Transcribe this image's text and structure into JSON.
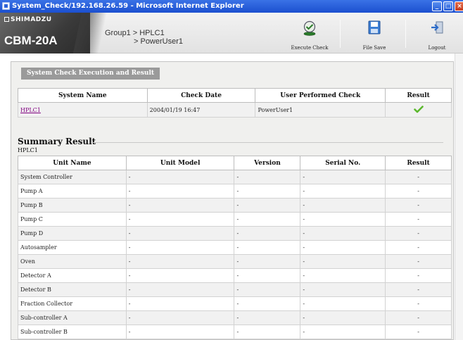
{
  "window": {
    "title": "System_Check/192.168.26.59 - Microsoft Internet Explorer"
  },
  "header": {
    "brand": "SHIMADZU",
    "model": "CBM-20A",
    "breadcrumb": [
      {
        "text": "Group1  >  HPLC1"
      },
      {
        "text": ">  PowerUser1"
      }
    ],
    "tools": {
      "execute_check": "Execute Check",
      "file_save": "File Save",
      "logout": "Logout"
    }
  },
  "section": {
    "tab_label": "System Check Execution and Result"
  },
  "check_table": {
    "headers": [
      "System Name",
      "Check Date",
      "User Performed Check",
      "Result"
    ],
    "row": {
      "system_name": "HPLC1",
      "check_date": "2004/01/19  16:47",
      "user": "PowerUser1",
      "result_icon": "checkmark-icon"
    }
  },
  "summary": {
    "title": "Summary Result",
    "subtitle": "HPLC1",
    "headers": [
      "Unit Name",
      "Unit Model",
      "Version",
      "Serial No.",
      "Result"
    ],
    "rows": [
      {
        "unit": "System Controller",
        "model": "-",
        "version": "-",
        "serial": "-",
        "result": "-"
      },
      {
        "unit": "Pump A",
        "model": "-",
        "version": "-",
        "serial": "-",
        "result": "-"
      },
      {
        "unit": "Pump B",
        "model": "-",
        "version": "-",
        "serial": "-",
        "result": "-"
      },
      {
        "unit": "Pump C",
        "model": "-",
        "version": "-",
        "serial": "-",
        "result": "-"
      },
      {
        "unit": "Pump D",
        "model": "-",
        "version": "-",
        "serial": "-",
        "result": "-"
      },
      {
        "unit": "Autosampler",
        "model": "-",
        "version": "-",
        "serial": "-",
        "result": "-"
      },
      {
        "unit": "Oven",
        "model": "-",
        "version": "-",
        "serial": "-",
        "result": "-"
      },
      {
        "unit": "Detector A",
        "model": "-",
        "version": "-",
        "serial": "-",
        "result": "-"
      },
      {
        "unit": "Detector B",
        "model": "-",
        "version": "-",
        "serial": "-",
        "result": "-"
      },
      {
        "unit": "Fraction Collector",
        "model": "-",
        "version": "-",
        "serial": "-",
        "result": "-"
      },
      {
        "unit": "Sub-controller A",
        "model": "-",
        "version": "-",
        "serial": "-",
        "result": "-"
      },
      {
        "unit": "Sub-controller B",
        "model": "-",
        "version": "-",
        "serial": "-",
        "result": "-"
      }
    ]
  },
  "colors": {
    "titlebar": "#1b4fcf",
    "header_dark": "#3a3a3a",
    "tab_gray": "#9a9a9a",
    "link_purple": "#800080",
    "check_green": "#5cb82e"
  }
}
